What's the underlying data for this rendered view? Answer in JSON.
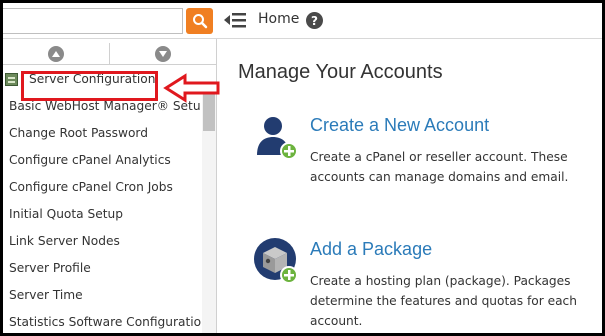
{
  "topbar": {
    "search_value": "",
    "home_label": "Home",
    "help_glyph": "?"
  },
  "sidebar": {
    "items": [
      {
        "label": "Server Configuration",
        "icon": "server-configuration-icon",
        "highlighted": true
      },
      {
        "label": "Basic WebHost Manager® Setup"
      },
      {
        "label": "Change Root Password"
      },
      {
        "label": "Configure cPanel Analytics"
      },
      {
        "label": "Configure cPanel Cron Jobs"
      },
      {
        "label": "Initial Quota Setup"
      },
      {
        "label": "Link Server Nodes"
      },
      {
        "label": "Server Profile"
      },
      {
        "label": "Server Time"
      },
      {
        "label": "Statistics Software Configuration"
      }
    ]
  },
  "main": {
    "title": "Manage Your Accounts",
    "features": [
      {
        "title": "Create a New Account",
        "description": "Create a cPanel or reseller account. These accounts can manage domains and email.",
        "icon": "add-user-icon"
      },
      {
        "title": "Add a Package",
        "description": "Create a hosting plan (package). Packages determine the features and quotas for each account.",
        "icon": "add-package-icon"
      }
    ]
  },
  "colors": {
    "accent_orange": "#f07f22",
    "link_blue": "#2b7bb9",
    "annotation_red": "#e0181e"
  }
}
